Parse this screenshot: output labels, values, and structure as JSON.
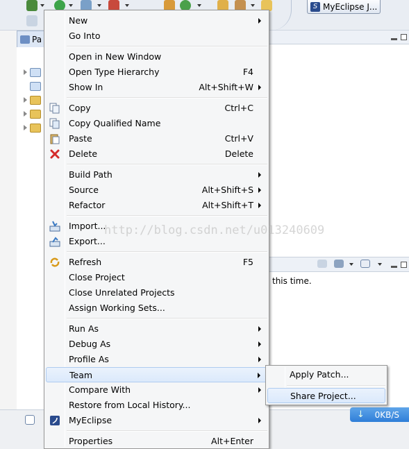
{
  "toolbar": {
    "perspective_label": "MyEclipse J..."
  },
  "left_pane": {
    "tab_label": "Pa"
  },
  "right_panel": {
    "message": "this time."
  },
  "status": {
    "net_speed": "0KB/S"
  },
  "watermark": "http://blog.csdn.net/u013240609",
  "colors": {
    "menu_bg": "#f5f6f7",
    "highlight": "#dbe9fb",
    "accent": "#2f7ed8"
  },
  "menu": {
    "items": [
      {
        "label": "New",
        "accel": "",
        "submenu": true
      },
      {
        "label": "Go Into",
        "accel": "",
        "submenu": false
      },
      {
        "label": "Open in New Window",
        "accel": "",
        "submenu": false
      },
      {
        "label": "Open Type Hierarchy",
        "accel": "F4",
        "submenu": false
      },
      {
        "label": "Show In",
        "accel": "Alt+Shift+W",
        "submenu": true
      },
      {
        "label": "Copy",
        "accel": "Ctrl+C",
        "icon": "copy-icon"
      },
      {
        "label": "Copy Qualified Name",
        "accel": "",
        "icon": "copy-qualified-icon"
      },
      {
        "label": "Paste",
        "accel": "Ctrl+V",
        "icon": "paste-icon"
      },
      {
        "label": "Delete",
        "accel": "Delete",
        "icon": "delete-icon"
      },
      {
        "label": "Build Path",
        "accel": "",
        "submenu": true
      },
      {
        "label": "Source",
        "accel": "Alt+Shift+S",
        "submenu": true
      },
      {
        "label": "Refactor",
        "accel": "Alt+Shift+T",
        "submenu": true
      },
      {
        "label": "Import...",
        "accel": "",
        "icon": "import-icon"
      },
      {
        "label": "Export...",
        "accel": "",
        "icon": "export-icon"
      },
      {
        "label": "Refresh",
        "accel": "F5",
        "icon": "refresh-icon"
      },
      {
        "label": "Close Project",
        "accel": ""
      },
      {
        "label": "Close Unrelated Projects",
        "accel": ""
      },
      {
        "label": "Assign Working Sets...",
        "accel": ""
      },
      {
        "label": "Run As",
        "accel": "",
        "submenu": true
      },
      {
        "label": "Debug As",
        "accel": "",
        "submenu": true
      },
      {
        "label": "Profile As",
        "accel": "",
        "submenu": true
      },
      {
        "label": "Team",
        "accel": "",
        "submenu": true,
        "highlighted": true
      },
      {
        "label": "Compare With",
        "accel": "",
        "submenu": true
      },
      {
        "label": "Restore from Local History...",
        "accel": ""
      },
      {
        "label": "MyEclipse",
        "accel": "",
        "submenu": true,
        "icon": "myeclipse-icon"
      },
      {
        "label": "Properties",
        "accel": "Alt+Enter"
      }
    ]
  },
  "team_submenu": {
    "items": [
      {
        "label": "Apply Patch..."
      },
      {
        "label": "Share Project...",
        "highlighted": true
      }
    ]
  }
}
